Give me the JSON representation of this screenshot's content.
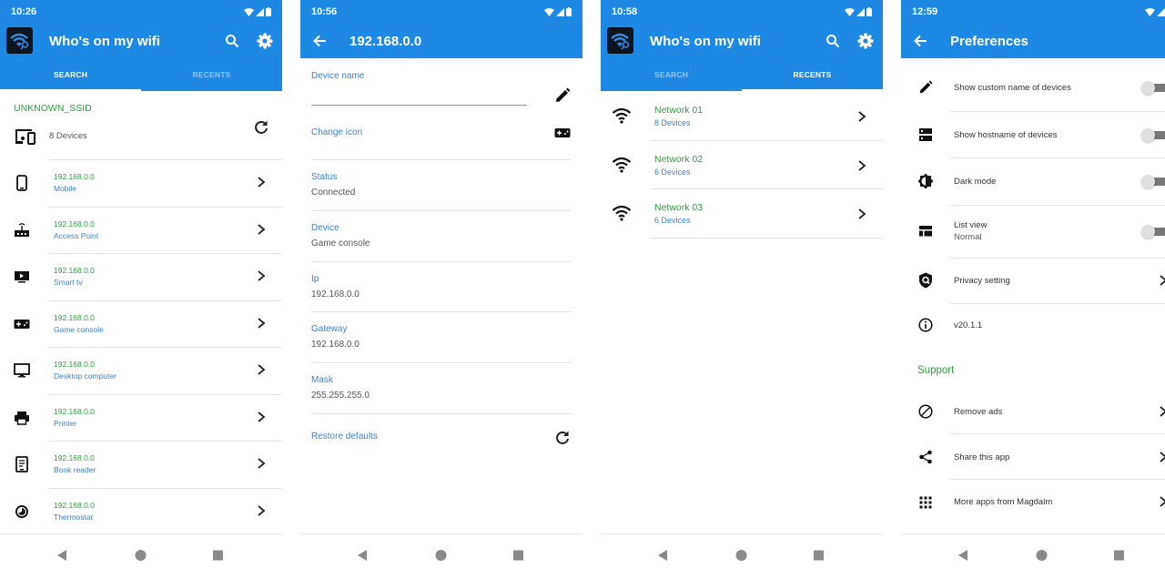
{
  "colors": {
    "primary": "#1e88e5",
    "accent_green": "#2e9e3e",
    "link_blue": "#3f7fc9"
  },
  "screen_search": {
    "status_time": "10:26",
    "app_title": "Who's on my wifi",
    "icons": {
      "logo": "wifi-search-logo",
      "search": "search-icon",
      "settings": "gear-icon"
    },
    "tabs": [
      {
        "label": "SEARCH",
        "active": true
      },
      {
        "label": "RECENTS",
        "active": false
      }
    ],
    "ssid": "UNKNOWN_SSID",
    "device_count": "8 Devices",
    "devices": [
      {
        "ip": "192.168.0.0",
        "type": "Mobile",
        "icon": "smartphone-icon"
      },
      {
        "ip": "192.168.0.0",
        "type": "Access Point",
        "icon": "router-icon"
      },
      {
        "ip": "192.168.0.0",
        "type": "Smart tv",
        "icon": "smart-tv-icon"
      },
      {
        "ip": "192.168.0.0",
        "type": "Game console",
        "icon": "gamepad-icon"
      },
      {
        "ip": "192.168.0.0",
        "type": "Desktop computer",
        "icon": "desktop-icon"
      },
      {
        "ip": "192.168.0.0",
        "type": "Printer",
        "icon": "printer-icon"
      },
      {
        "ip": "192.168.0.0",
        "type": "Book reader",
        "icon": "ebook-reader-icon"
      },
      {
        "ip": "192.168.0.0",
        "type": "Thermostat",
        "icon": "thermostat-icon"
      }
    ]
  },
  "screen_device": {
    "status_time": "10:56",
    "title": "192.168.0.0",
    "device_name_label": "Device name",
    "device_name_value": "",
    "change_icon_label": "Change icon",
    "fields": [
      {
        "label": "Status",
        "value": "Connected"
      },
      {
        "label": "Device",
        "value": "Game console"
      },
      {
        "label": "Ip",
        "value": "192.168.0.0"
      },
      {
        "label": "Gateway",
        "value": "192.168.0.0"
      },
      {
        "label": "Mask",
        "value": "255.255.255.0"
      }
    ],
    "restore_label": "Restore defaults"
  },
  "screen_recents": {
    "status_time": "10:58",
    "app_title": "Who's on my wifi",
    "tabs": [
      {
        "label": "SEARCH",
        "active": false
      },
      {
        "label": "RECENTS",
        "active": true
      }
    ],
    "networks": [
      {
        "name": "Network 01",
        "devices": "8 Devices"
      },
      {
        "name": "Network 02",
        "devices": "6 Devices"
      },
      {
        "name": "Network 03",
        "devices": "6 Devices"
      }
    ]
  },
  "screen_prefs": {
    "status_time": "12:59",
    "title": "Preferences",
    "items": [
      {
        "label": "Show custom name of devices",
        "control": "switch",
        "on": false,
        "icon": "pencil-icon"
      },
      {
        "label": "Show hostname of devices",
        "control": "switch",
        "on": false,
        "icon": "dns-icon"
      },
      {
        "label": "Dark mode",
        "control": "switch",
        "on": false,
        "icon": "brightness-icon"
      },
      {
        "label": "List view",
        "sublabel": "Normal",
        "control": "switch",
        "on": false,
        "icon": "view-list-icon"
      },
      {
        "label": "Privacy setting",
        "control": "chevron",
        "icon": "privacy-shield-icon"
      },
      {
        "label": "v20.1.1",
        "control": "none",
        "icon": "info-icon"
      }
    ],
    "support_title": "Support",
    "support_items": [
      {
        "label": "Remove ads",
        "icon": "block-icon"
      },
      {
        "label": "Share this app",
        "icon": "share-icon"
      },
      {
        "label": "More apps from Magdalm",
        "icon": "apps-grid-icon"
      }
    ]
  }
}
